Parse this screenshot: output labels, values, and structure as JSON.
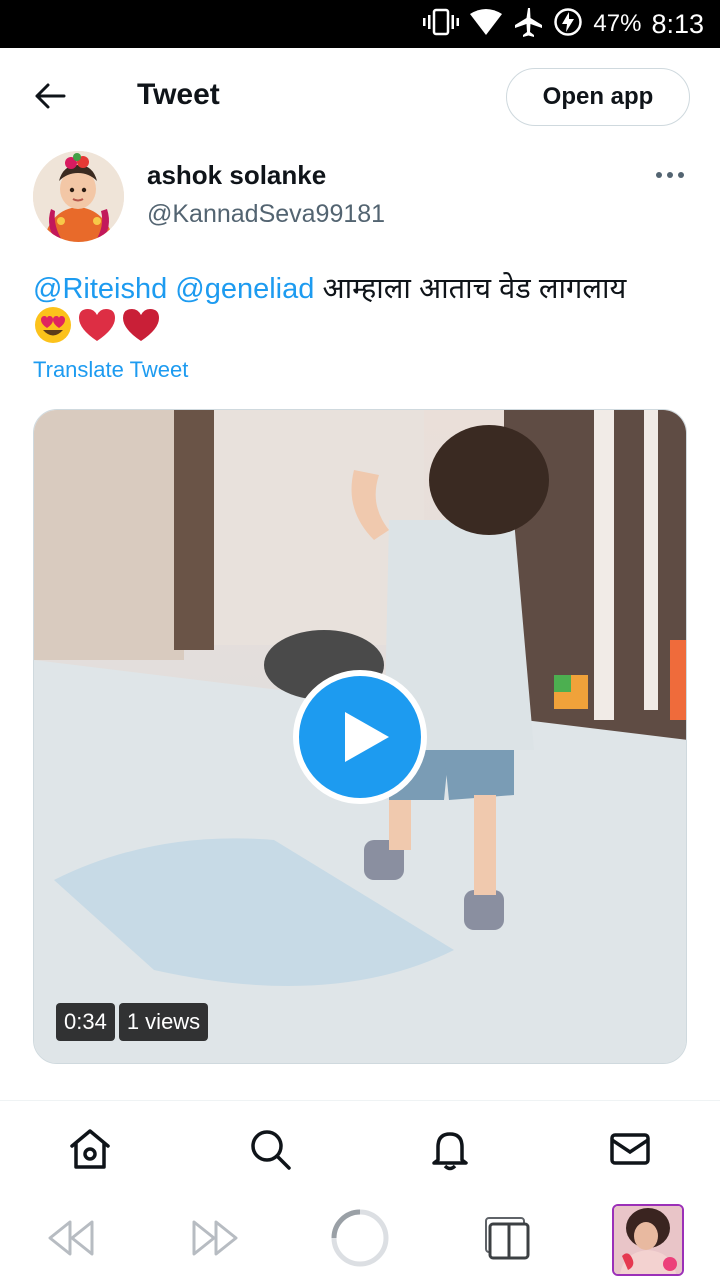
{
  "status_bar": {
    "battery": "47%",
    "time": "8:13"
  },
  "header": {
    "title": "Tweet",
    "open_app_label": "Open app"
  },
  "tweet": {
    "display_name": "ashok solanke",
    "handle": "@KannadSeva99181",
    "mentions": [
      "@Riteishd",
      "@geneliad"
    ],
    "text": "आम्हाला आताच वेड लागलाय",
    "emojis": [
      "heart-eyes-emoji",
      "red-heart-emoji",
      "red-heart-emoji"
    ],
    "translate_label": "Translate Tweet",
    "video": {
      "duration": "0:34",
      "views": "1 views"
    }
  },
  "bottom_nav": [
    "home-icon",
    "search-icon",
    "notifications-icon",
    "messages-icon"
  ],
  "browser_bar": [
    "back-icon",
    "forward-icon",
    "loading-icon",
    "tabs-icon",
    "profile-thumbnail"
  ],
  "colors": {
    "accent": "#1d9bf0",
    "text": "#0f1419",
    "secondary": "#536471",
    "border": "#cfd9de"
  }
}
